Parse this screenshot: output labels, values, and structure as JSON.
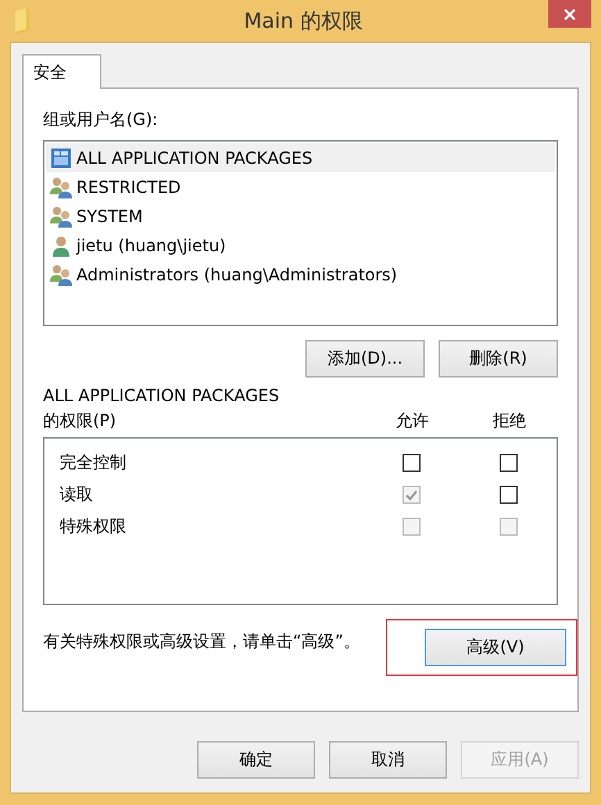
{
  "window": {
    "title": "Main 的权限"
  },
  "tabs": [
    {
      "label": "安全",
      "selected": true
    }
  ],
  "principals": {
    "label": "组或用户名(G):",
    "items": [
      {
        "name": "ALL APPLICATION PACKAGES",
        "kind": "package",
        "selected": true
      },
      {
        "name": "RESTRICTED",
        "kind": "group",
        "selected": false
      },
      {
        "name": "SYSTEM",
        "kind": "group",
        "selected": false
      },
      {
        "name": "jietu (huang\\jietu)",
        "kind": "user",
        "selected": false
      },
      {
        "name": "Administrators (huang\\Administrators)",
        "kind": "group",
        "selected": false
      }
    ]
  },
  "principal_buttons": [
    "添加(D)...",
    "删除(R)"
  ],
  "permissions": {
    "label_line_1": "ALL APPLICATION PACKAGES",
    "label_line_2": "的权限(P)",
    "allow_header": "允许",
    "deny_header": "拒绝",
    "rows": [
      {
        "name": "完全控制",
        "allow": {
          "checked": false,
          "disabled": false
        },
        "deny": {
          "checked": false,
          "disabled": false
        }
      },
      {
        "name": "读取",
        "allow": {
          "checked": true,
          "disabled": true
        },
        "deny": {
          "checked": false,
          "disabled": false
        }
      },
      {
        "name": "特殊权限",
        "allow": {
          "checked": false,
          "disabled": true
        },
        "deny": {
          "checked": false,
          "disabled": true
        }
      }
    ]
  },
  "advanced": {
    "note": "有关特殊权限或高级设置，请单击“高级”。",
    "button": "高级(V)",
    "highlighted": true
  },
  "footer_buttons": [
    {
      "label": "确定",
      "disabled": false
    },
    {
      "label": "取消",
      "disabled": false
    },
    {
      "label": "应用(A)",
      "disabled": true
    }
  ]
}
